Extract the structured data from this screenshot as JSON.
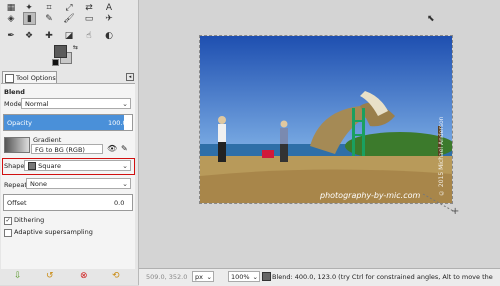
{
  "toolbox": {
    "tools": [
      "rect-select-icon",
      "fuzzy-select-icon",
      "crop-icon",
      "scale-icon",
      "flip-icon",
      "text-icon",
      "blend-icon",
      "pencil-icon",
      "paintbrush-icon",
      "eraser-icon",
      "airbrush-icon",
      "ink-icon",
      "clone-icon",
      "heal-icon",
      "perspective-clone-icon",
      "smudge-icon",
      "dodge-icon",
      "color-picker-icon"
    ]
  },
  "tab_label": "Tool Options",
  "tool_options": {
    "title": "Blend",
    "mode_label": "Mode:",
    "mode_value": "Normal",
    "opacity_label": "Opacity",
    "opacity_value": "100.0",
    "gradient_label": "Gradient",
    "gradient_value": "FG to BG (RGB)",
    "shape_label": "Shape:",
    "shape_value": "Square",
    "repeat_label": "Repeat:",
    "repeat_value": "None",
    "offset_label": "Offset",
    "offset_value": "0.0",
    "dithering_label": "Dithering",
    "dithering_checked": true,
    "adaptive_label": "Adaptive supersampling",
    "adaptive_checked": false
  },
  "image": {
    "watermark": "photography-by-mic.com",
    "vertical_watermark": "© 2015 Michael Anderson"
  },
  "status": {
    "coords": "509.0, 352.0",
    "unit": "px",
    "zoom": "100%",
    "message": "Blend: 400.0, 123.0 (try Ctrl for constrained angles, Alt to move the"
  },
  "colors": {
    "opacity_fill": "#4a90d9",
    "shape_highlight": "#d01010",
    "fg": "#5a5a5a",
    "bg": "#c8c8c8"
  }
}
